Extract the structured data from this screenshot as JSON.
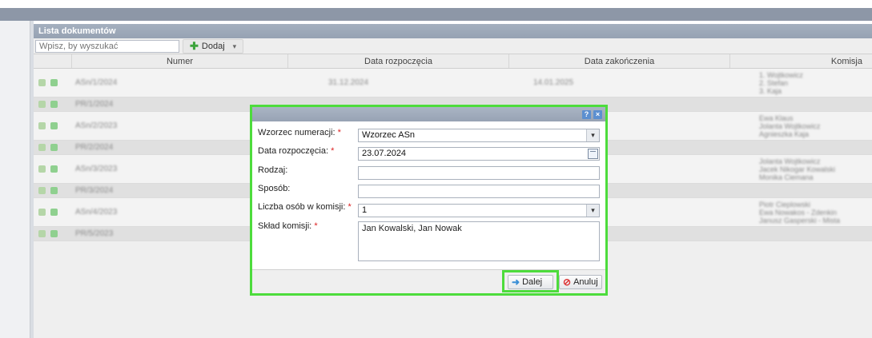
{
  "panel": {
    "title": "Lista dokumentów",
    "search_placeholder": "Wpisz, by wyszukać",
    "add_label": "Dodaj",
    "columns": [
      "Numer",
      "Data rozpoczęcia",
      "Data zakończenia",
      "Komisja"
    ]
  },
  "rows": [
    {
      "numer": "ASn/1/2024",
      "start": "31.12.2024",
      "end": "14.01.2025",
      "komisja": "1. Wojtkowicz\n2. Stefan\n3. Kaja"
    },
    {
      "numer": "PR/1/2024",
      "start": "",
      "end": "",
      "komisja": ""
    },
    {
      "numer": "ASn/2/2023",
      "start": "",
      "end": "",
      "komisja": "Ewa Klaus\nJolanta Wojtkowicz\nAgnieszka Kaja"
    },
    {
      "numer": "PR/2/2024",
      "start": "",
      "end": "",
      "komisja": ""
    },
    {
      "numer": "ASn/3/2023",
      "start": "",
      "end": "",
      "komisja": "Jolanta Wojtkowicz\nJacek Nikogar Kowalski\nMonika Ciemana"
    },
    {
      "numer": "PR/3/2024",
      "start": "",
      "end": "",
      "komisja": ""
    },
    {
      "numer": "ASn/4/2023",
      "start": "",
      "end": "",
      "komisja": "Piotr Cieplowski\nEwa Nowakos - Zdenkin\nJanusz Gasperski - Mista"
    },
    {
      "numer": "PR/5/2023",
      "start": "",
      "end": "",
      "komisja": ""
    }
  ],
  "dialog": {
    "help": "?",
    "close": "×",
    "fields": {
      "wzorzec_label": "Wzorzec numeracji:",
      "wzorzec_value": "Wzorzec ASn",
      "data_label": "Data rozpoczęcia:",
      "data_value": "23.07.2024",
      "rodzaj_label": "Rodzaj:",
      "rodzaj_value": "",
      "sposob_label": "Sposób:",
      "sposob_value": "",
      "liczba_label": "Liczba osób w komisji:",
      "liczba_value": "1",
      "sklad_label": "Skład komisji:",
      "sklad_value": "Jan Kowalski, Jan Nowak"
    },
    "required_mark": "*",
    "next_label": "Dalej",
    "cancel_label": "Anuluj"
  }
}
